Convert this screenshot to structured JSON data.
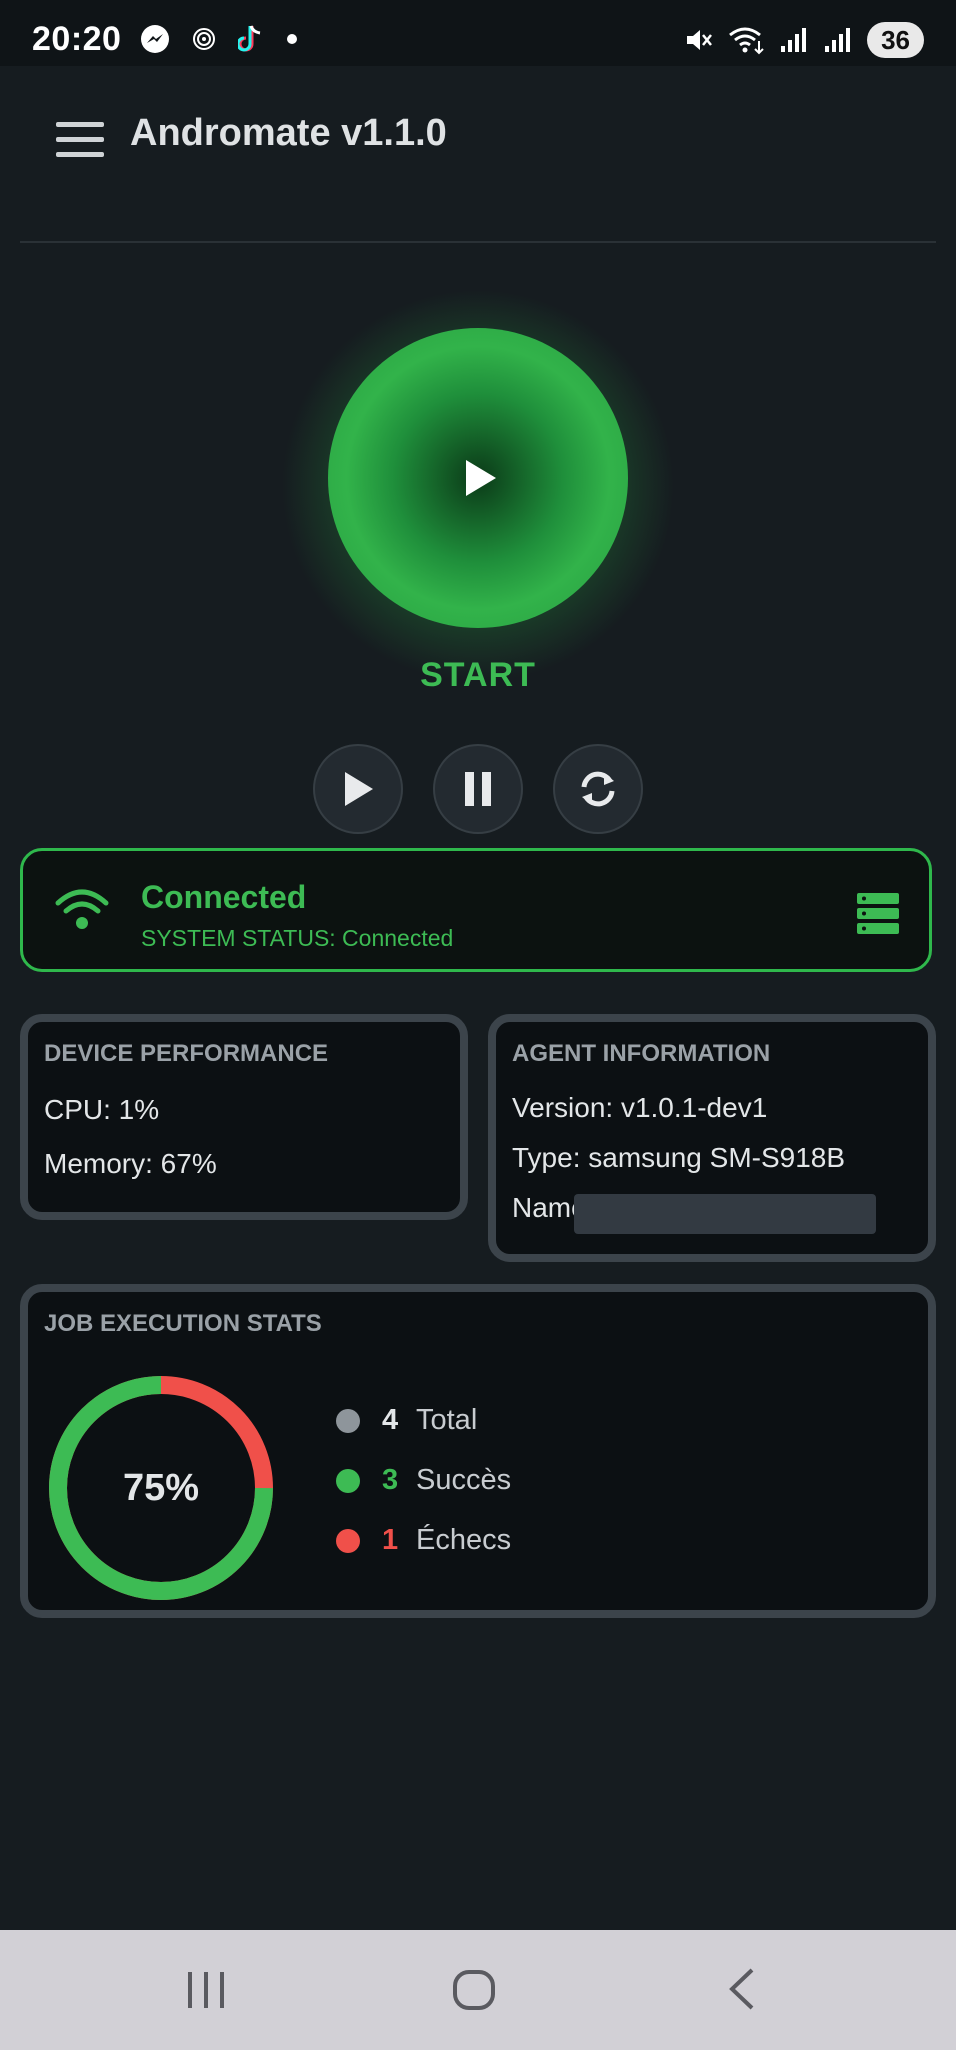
{
  "status_bar": {
    "time": "20:20",
    "battery": "36",
    "left_icons": [
      "messenger-icon",
      "hotspot-icon",
      "tiktok-icon",
      "dot-icon"
    ],
    "right_icons": [
      "mute-icon",
      "wifi-icon",
      "signal-icon",
      "signal-icon"
    ]
  },
  "app_bar": {
    "title": "Andromate v1.1.0"
  },
  "start": {
    "label": "START"
  },
  "controls": [
    "play-icon",
    "pause-icon",
    "refresh-icon"
  ],
  "connection": {
    "title": "Connected",
    "subtitle": "SYSTEM STATUS: Connected"
  },
  "device_performance": {
    "title": "DEVICE PERFORMANCE",
    "cpu": "CPU: 1%",
    "memory": "Memory: 67%"
  },
  "agent_information": {
    "title": "AGENT INFORMATION",
    "version": "Version: v1.0.1-dev1",
    "type": "Type: samsung SM-S918B",
    "name": "Name"
  },
  "job_stats": {
    "title": "JOB EXECUTION STATS",
    "percent_label": "75%",
    "success_fraction": 0.75,
    "total": {
      "value": "4",
      "label": "Total"
    },
    "success": {
      "value": "3",
      "label": "Succès"
    },
    "failure": {
      "value": "1",
      "label": "Échecs"
    }
  },
  "colors": {
    "accent_green": "#3dbb54",
    "failure_red": "#f0504a",
    "neutral_gray": "#8e959b",
    "background": "#161c20"
  },
  "nav_bar": [
    "recents-icon",
    "home-icon",
    "back-icon"
  ]
}
